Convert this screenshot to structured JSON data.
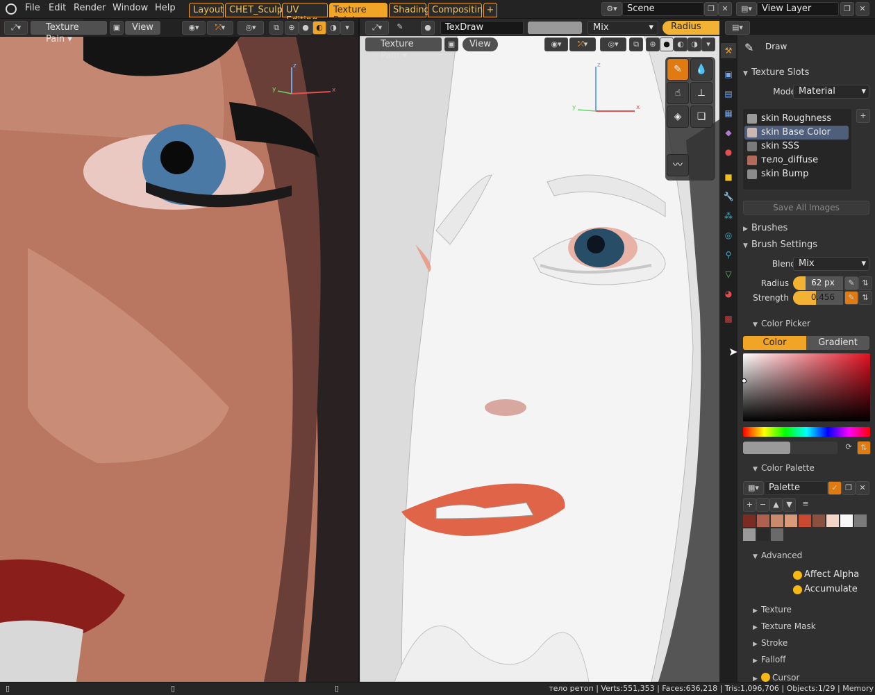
{
  "topbar": {
    "menus": [
      "File",
      "Edit",
      "Render",
      "Window",
      "Help"
    ],
    "workspaces": [
      "Layout",
      "CHET_Sculpt",
      "UV Editing",
      "Texture Paint",
      "Shading",
      "Compositing",
      "+"
    ],
    "active_workspace": "Texture Paint",
    "scene": "Scene",
    "view_layer": "View Layer"
  },
  "left_viewport": {
    "mode": "Texture Pain",
    "view_menu": "View",
    "axes": {
      "x": "x",
      "y": "y",
      "z": "z"
    }
  },
  "tool_header": {
    "brush_name": "TexDraw",
    "blend": "Mix",
    "radius_label": "Radius"
  },
  "right_viewport": {
    "mode": "Texture Pain",
    "view_menu": "View",
    "axes": {
      "x": "x",
      "y": "y",
      "z": "z"
    }
  },
  "sidebar": {
    "tool_name": "Draw",
    "texture_slots_title": "Texture Slots",
    "mode_label": "Mode",
    "mode_value": "Material",
    "slots": [
      {
        "label": "skin Roughness",
        "color": "#9a9a9a"
      },
      {
        "label": "skin Base Color",
        "color": "#c9b8b0"
      },
      {
        "label": "skin SSS",
        "color": "#7a7a7a"
      },
      {
        "label": "тело_diffuse",
        "color": "#b06a5a"
      },
      {
        "label": "skin Bump",
        "color": "#8a8a8a"
      }
    ],
    "selected_slot": "skin Base Color",
    "save_all": "Save All Images",
    "brushes_title": "Brushes",
    "brush_settings_title": "Brush Settings",
    "blend_label": "Blend",
    "blend_value": "Mix",
    "radius_label": "Radius",
    "radius_value": "62 px",
    "strength_label": "Strength",
    "strength_value": "0.456",
    "strength_fraction": 0.456,
    "color_picker_title": "Color Picker",
    "color_tab": "Color",
    "gradient_tab": "Gradient",
    "color_palette_title": "Color Palette",
    "palette_name": "Palette",
    "palette_colors": [
      "#7a2c22",
      "#b0604f",
      "#c98a6e",
      "#d89a78",
      "#c94a30",
      "#8a5040",
      "#f4d6c8",
      "#f8f8f8",
      "#7a7a7a",
      "#9a9a9a",
      "#2a2a2a",
      "#6a6a6a"
    ],
    "advanced_title": "Advanced",
    "affect_alpha": "Affect Alpha",
    "accumulate": "Accumulate",
    "collapsed_panels": [
      "Texture",
      "Texture Mask",
      "Stroke",
      "Falloff",
      "Cursor"
    ]
  },
  "statusbar": {
    "info": "тело ретоп | Verts:551,353 | Faces:636,218 | Tris:1,096,706 | Objects:1/29 | Memory"
  },
  "colors": {
    "accent": "#f0a527",
    "active_tool": "#e07b12",
    "selection": "#4f5e7a"
  }
}
